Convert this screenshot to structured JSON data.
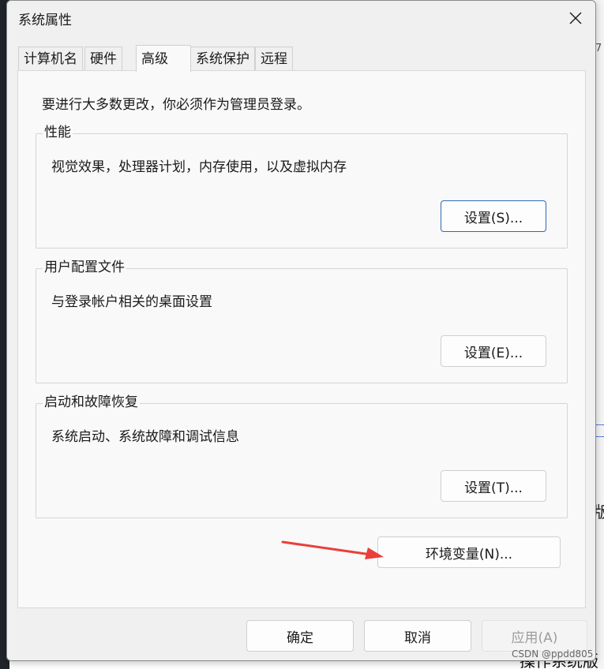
{
  "window": {
    "title": "系统属性"
  },
  "tabs": [
    {
      "label": "计算机名"
    },
    {
      "label": "硬件"
    },
    {
      "label": "高级",
      "active": true
    },
    {
      "label": "系统保护"
    },
    {
      "label": "远程"
    }
  ],
  "admin_note": "要进行大多数更改，你必须作为管理员登录。",
  "groups": {
    "performance": {
      "title": "性能",
      "description": "视觉效果，处理器计划，内存使用，以及虚拟内存",
      "button": "设置(S)..."
    },
    "user_profiles": {
      "title": "用户配置文件",
      "description": "与登录帐户相关的桌面设置",
      "button": "设置(E)..."
    },
    "startup_recovery": {
      "title": "启动和故障恢复",
      "description": "系统启动、系统故障和调试信息",
      "button": "设置(T)..."
    }
  },
  "env_vars_button": "环境变量(N)...",
  "footer": {
    "ok": "确定",
    "cancel": "取消",
    "apply": "应用(A)"
  },
  "background": {
    "right_fragment_1": "7",
    "right_fragment_2": "版",
    "bottom_text": "操作系统版",
    "watermark": "CSDN @ppdd805"
  },
  "colors": {
    "annotation_arrow": "#e8403a",
    "primary_border": "#2a68b8"
  }
}
